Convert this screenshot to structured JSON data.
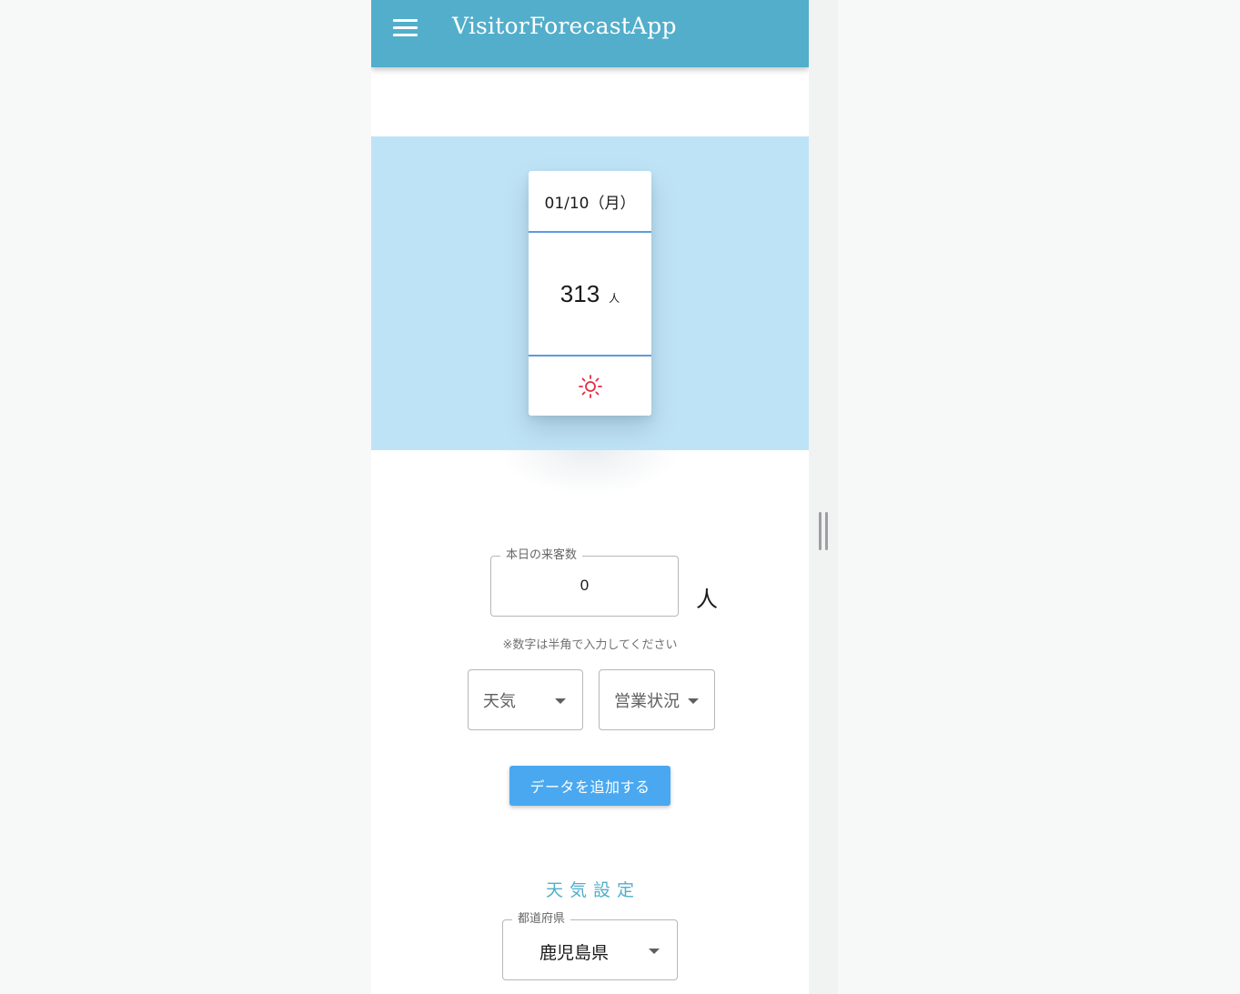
{
  "appbar": {
    "title": "VisitorForecastApp",
    "menu_icon": "hamburger-menu-icon",
    "color": "#52aecb"
  },
  "forecast_card": {
    "date": "01/10（月）",
    "count": "313",
    "unit": "人",
    "weather_icon": "sun-icon",
    "weather_color": "#e8293f",
    "divider_color": "#5b9ae3",
    "hero_color": "#bfe3f6"
  },
  "form": {
    "visitors_label": "本日の来客数",
    "visitors_value": "0",
    "visitors_unit": "人",
    "hint": "※数字は半角で入力してください",
    "weather_select_label": "天気",
    "status_select_label": "営業状況",
    "add_button_label": "データを追加する",
    "button_color": "#4aa8f0"
  },
  "weather_settings": {
    "section_title": "天気設定",
    "prefecture_label": "都道府県",
    "prefecture_value": "鹿児島県"
  }
}
